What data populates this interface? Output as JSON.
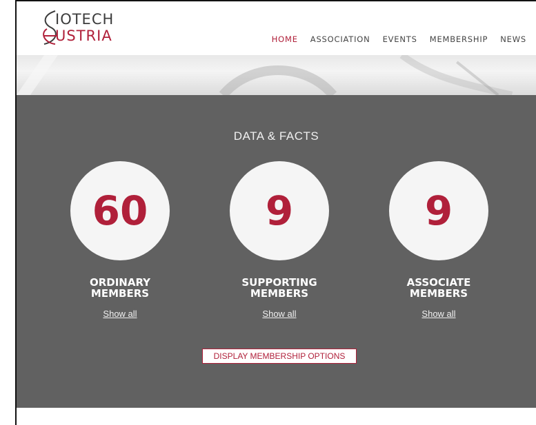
{
  "logo": {
    "line1": "IOTECH",
    "line2": "USTRIA"
  },
  "nav": [
    "HOME",
    "ASSOCIATION",
    "EVENTS",
    "MEMBERSHIP",
    "NEWS"
  ],
  "section": {
    "title": "DATA & FACTS",
    "stats": [
      {
        "number": "60",
        "label_line1": "ORDINARY",
        "label_line2": "MEMBERS",
        "link": "Show all"
      },
      {
        "number": "9",
        "label_line1": "SUPPORTING",
        "label_line2": "MEMBERS",
        "link": "Show all"
      },
      {
        "number": "9",
        "label_line1": "ASSOCIATE",
        "label_line2": "MEMBERS",
        "link": "Show all"
      }
    ],
    "cta": "DISPLAY MEMBERSHIP OPTIONS"
  },
  "colors": {
    "accent": "#b0203a",
    "section_bg": "#616161"
  }
}
